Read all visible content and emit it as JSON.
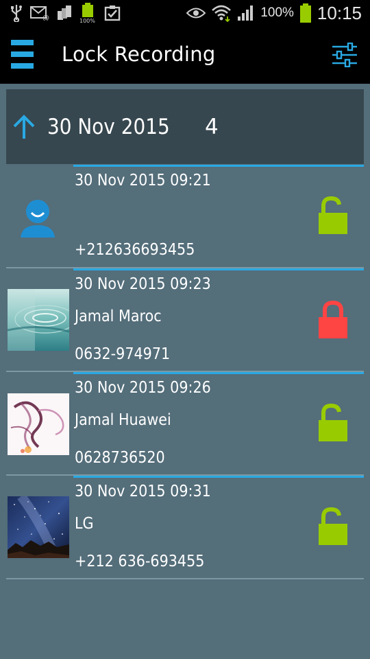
{
  "status_bar": {
    "battery_percent": "100%",
    "time": "10:15",
    "icons": [
      "usb-icon",
      "email-icon",
      "sim-icon",
      "battery-full-icon",
      "clipboard-check-icon",
      "eye-icon",
      "wifi-icon",
      "signal-icon",
      "battery-icon"
    ]
  },
  "app_bar": {
    "title": "Lock Recording",
    "menu_icon": "hamburger-menu-icon",
    "filter_icon": "sliders-icon"
  },
  "group": {
    "date": "30 Nov 2015",
    "count": "4",
    "icon": "arrow-up-icon"
  },
  "recordings": [
    {
      "datetime": "30 Nov 2015  09:21",
      "name": "",
      "number": "+212636693455",
      "locked": false,
      "avatar": "default-contact-icon"
    },
    {
      "datetime": "30 Nov 2015  09:23",
      "name": "Jamal Maroc",
      "number": "0632-974971",
      "locked": true,
      "avatar": "water-drop-photo"
    },
    {
      "datetime": "30 Nov 2015  09:26",
      "name": "Jamal Huawei",
      "number": "0628736520",
      "locked": false,
      "avatar": "smoke-art-photo"
    },
    {
      "datetime": "30 Nov 2015  09:31",
      "name": "LG",
      "number": "+212 636-693455",
      "locked": false,
      "avatar": "night-sky-photo"
    }
  ],
  "colors": {
    "accent": "#29a9e3",
    "unlocked": "#99cc00",
    "locked": "#ff4444",
    "background": "#546e7a",
    "header": "#37474f"
  }
}
